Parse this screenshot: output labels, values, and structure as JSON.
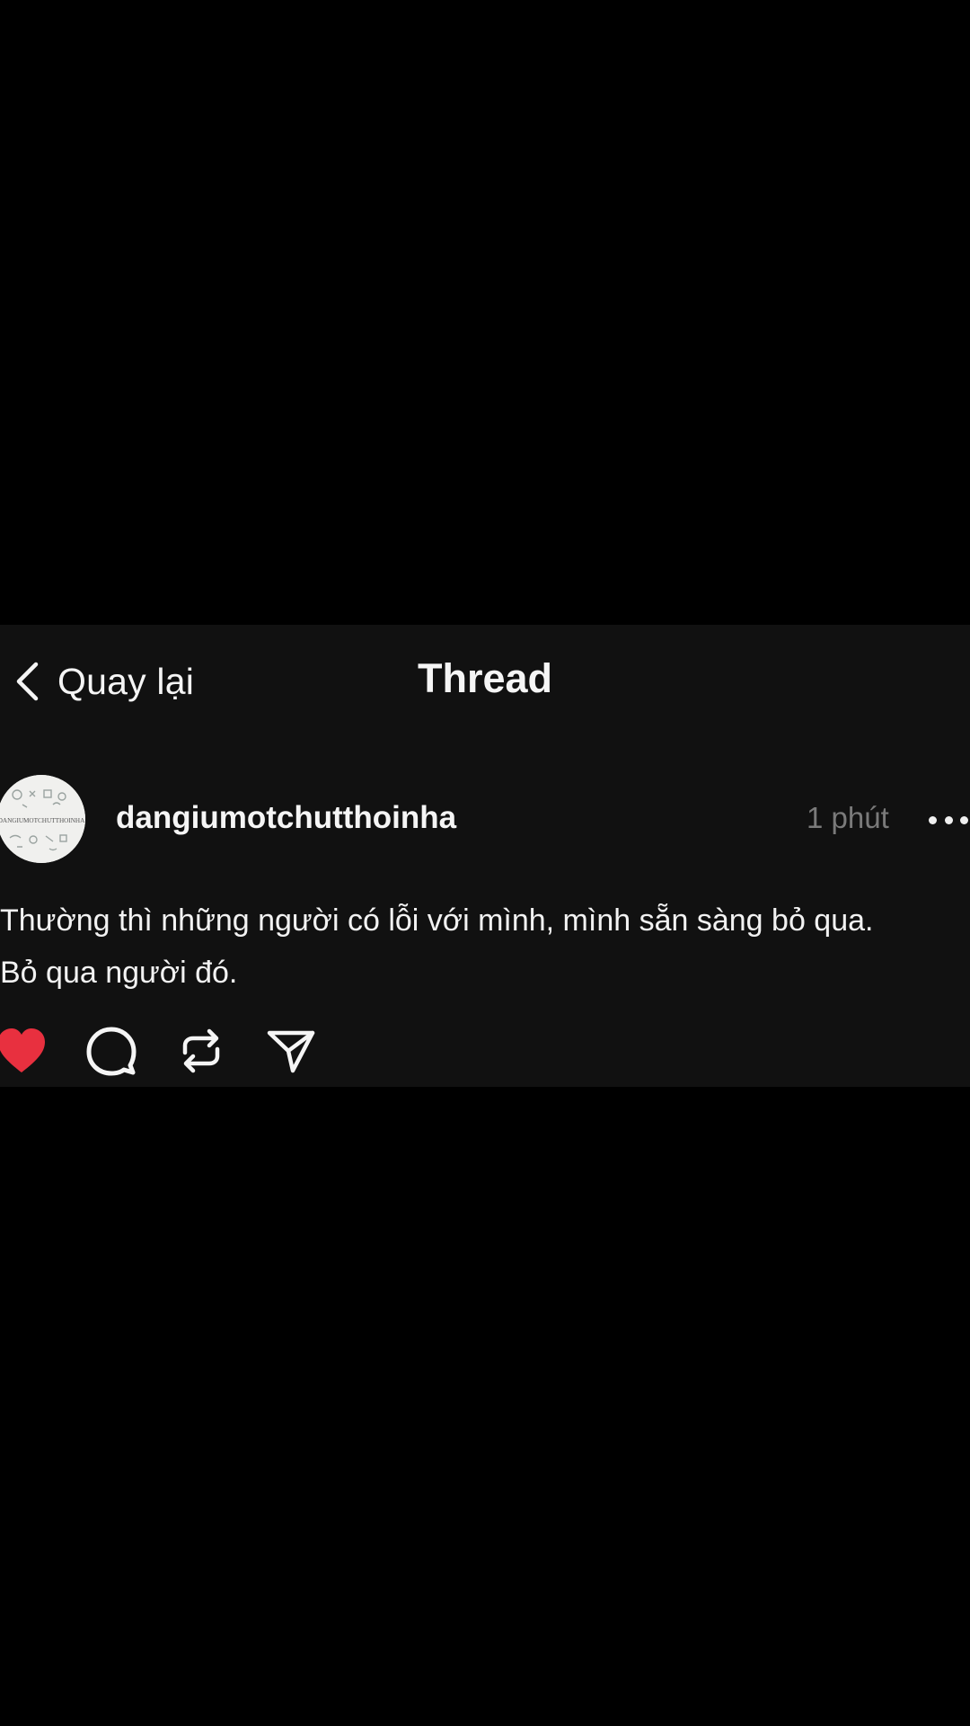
{
  "nav": {
    "back_label": "Quay lại",
    "title": "Thread"
  },
  "post": {
    "username": "dangiumotchutthoinha",
    "time": "1 phút",
    "avatar_text": "DANGIUMOTCHUTTHOINHA",
    "text_lines": [
      "Thường thì những người có lỗi với mình, mình sẵn sàng bỏ qua.",
      "Bỏ qua người đó."
    ],
    "liked": true
  },
  "icons": {
    "back": "chevron-left-icon",
    "more": "more-horizontal-icon",
    "like": "heart-icon",
    "comment": "comment-icon",
    "repost": "repost-icon",
    "share": "send-icon"
  },
  "colors": {
    "background": "#000000",
    "card": "#111111",
    "text": "#f5f5f5",
    "muted": "#7a7a7a",
    "like": "#e8303f"
  }
}
